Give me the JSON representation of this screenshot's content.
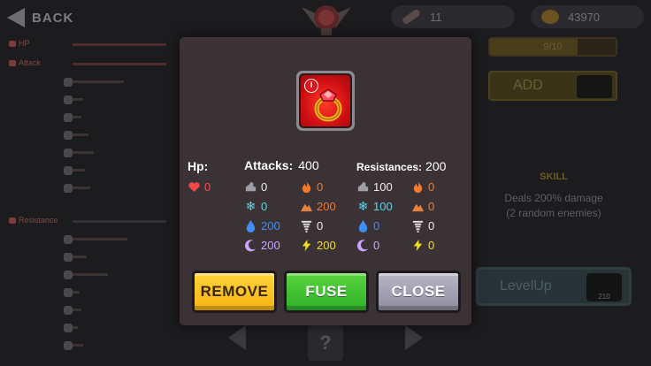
{
  "topbar": {
    "back_label": "BACK",
    "scrolls_count": "11",
    "coins_count": "43970"
  },
  "sidebar": {
    "hp_label": "HP",
    "attack_label": "Attack",
    "resistance_label": "Resistance"
  },
  "right_panel": {
    "progress_text": "9/10",
    "add_label": "ADD",
    "skill_title": "SKILL",
    "skill_desc_line1": "Deals 200% damage",
    "skill_desc_line2": "(2 random enemies)",
    "levelup_label": "LevelUp",
    "levelup_cost": "210"
  },
  "modal": {
    "item_badge": "I",
    "item_icon": "ruby-ring-icon",
    "hp": {
      "label": "Hp:",
      "value": "0"
    },
    "attacks": {
      "label": "Attacks:",
      "total": "400",
      "physical": "0",
      "fire": "0",
      "ice": "0",
      "earth": "200",
      "water": "200",
      "wind": "0",
      "dark": "200",
      "lightning": "200"
    },
    "resistances": {
      "label": "Resistances:",
      "total": "200",
      "physical": "100",
      "fire": "0",
      "ice": "100",
      "earth": "0",
      "water": "0",
      "wind": "0",
      "dark": "0",
      "lightning": "0"
    },
    "buttons": {
      "remove": "REMOVE",
      "fuse": "FUSE",
      "close": "CLOSE"
    }
  },
  "colors": {
    "modal_bg": "#3b3236",
    "remove_btn": "#f7b213",
    "fuse_btn": "#2fb02b",
    "close_btn": "#8e8c9e",
    "item_bg": "#d10f12"
  },
  "bottom_nav": {
    "help_glyph": "?"
  }
}
